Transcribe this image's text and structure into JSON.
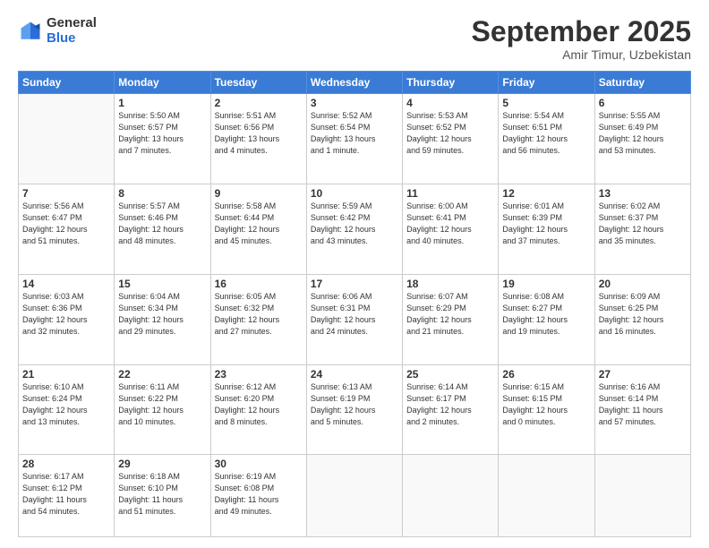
{
  "logo": {
    "general": "General",
    "blue": "Blue"
  },
  "header": {
    "month": "September 2025",
    "location": "Amir Timur, Uzbekistan"
  },
  "weekdays": [
    "Sunday",
    "Monday",
    "Tuesday",
    "Wednesday",
    "Thursday",
    "Friday",
    "Saturday"
  ],
  "weeks": [
    [
      {
        "day": "",
        "info": ""
      },
      {
        "day": "1",
        "info": "Sunrise: 5:50 AM\nSunset: 6:57 PM\nDaylight: 13 hours\nand 7 minutes."
      },
      {
        "day": "2",
        "info": "Sunrise: 5:51 AM\nSunset: 6:56 PM\nDaylight: 13 hours\nand 4 minutes."
      },
      {
        "day": "3",
        "info": "Sunrise: 5:52 AM\nSunset: 6:54 PM\nDaylight: 13 hours\nand 1 minute."
      },
      {
        "day": "4",
        "info": "Sunrise: 5:53 AM\nSunset: 6:52 PM\nDaylight: 12 hours\nand 59 minutes."
      },
      {
        "day": "5",
        "info": "Sunrise: 5:54 AM\nSunset: 6:51 PM\nDaylight: 12 hours\nand 56 minutes."
      },
      {
        "day": "6",
        "info": "Sunrise: 5:55 AM\nSunset: 6:49 PM\nDaylight: 12 hours\nand 53 minutes."
      }
    ],
    [
      {
        "day": "7",
        "info": "Sunrise: 5:56 AM\nSunset: 6:47 PM\nDaylight: 12 hours\nand 51 minutes."
      },
      {
        "day": "8",
        "info": "Sunrise: 5:57 AM\nSunset: 6:46 PM\nDaylight: 12 hours\nand 48 minutes."
      },
      {
        "day": "9",
        "info": "Sunrise: 5:58 AM\nSunset: 6:44 PM\nDaylight: 12 hours\nand 45 minutes."
      },
      {
        "day": "10",
        "info": "Sunrise: 5:59 AM\nSunset: 6:42 PM\nDaylight: 12 hours\nand 43 minutes."
      },
      {
        "day": "11",
        "info": "Sunrise: 6:00 AM\nSunset: 6:41 PM\nDaylight: 12 hours\nand 40 minutes."
      },
      {
        "day": "12",
        "info": "Sunrise: 6:01 AM\nSunset: 6:39 PM\nDaylight: 12 hours\nand 37 minutes."
      },
      {
        "day": "13",
        "info": "Sunrise: 6:02 AM\nSunset: 6:37 PM\nDaylight: 12 hours\nand 35 minutes."
      }
    ],
    [
      {
        "day": "14",
        "info": "Sunrise: 6:03 AM\nSunset: 6:36 PM\nDaylight: 12 hours\nand 32 minutes."
      },
      {
        "day": "15",
        "info": "Sunrise: 6:04 AM\nSunset: 6:34 PM\nDaylight: 12 hours\nand 29 minutes."
      },
      {
        "day": "16",
        "info": "Sunrise: 6:05 AM\nSunset: 6:32 PM\nDaylight: 12 hours\nand 27 minutes."
      },
      {
        "day": "17",
        "info": "Sunrise: 6:06 AM\nSunset: 6:31 PM\nDaylight: 12 hours\nand 24 minutes."
      },
      {
        "day": "18",
        "info": "Sunrise: 6:07 AM\nSunset: 6:29 PM\nDaylight: 12 hours\nand 21 minutes."
      },
      {
        "day": "19",
        "info": "Sunrise: 6:08 AM\nSunset: 6:27 PM\nDaylight: 12 hours\nand 19 minutes."
      },
      {
        "day": "20",
        "info": "Sunrise: 6:09 AM\nSunset: 6:25 PM\nDaylight: 12 hours\nand 16 minutes."
      }
    ],
    [
      {
        "day": "21",
        "info": "Sunrise: 6:10 AM\nSunset: 6:24 PM\nDaylight: 12 hours\nand 13 minutes."
      },
      {
        "day": "22",
        "info": "Sunrise: 6:11 AM\nSunset: 6:22 PM\nDaylight: 12 hours\nand 10 minutes."
      },
      {
        "day": "23",
        "info": "Sunrise: 6:12 AM\nSunset: 6:20 PM\nDaylight: 12 hours\nand 8 minutes."
      },
      {
        "day": "24",
        "info": "Sunrise: 6:13 AM\nSunset: 6:19 PM\nDaylight: 12 hours\nand 5 minutes."
      },
      {
        "day": "25",
        "info": "Sunrise: 6:14 AM\nSunset: 6:17 PM\nDaylight: 12 hours\nand 2 minutes."
      },
      {
        "day": "26",
        "info": "Sunrise: 6:15 AM\nSunset: 6:15 PM\nDaylight: 12 hours\nand 0 minutes."
      },
      {
        "day": "27",
        "info": "Sunrise: 6:16 AM\nSunset: 6:14 PM\nDaylight: 11 hours\nand 57 minutes."
      }
    ],
    [
      {
        "day": "28",
        "info": "Sunrise: 6:17 AM\nSunset: 6:12 PM\nDaylight: 11 hours\nand 54 minutes."
      },
      {
        "day": "29",
        "info": "Sunrise: 6:18 AM\nSunset: 6:10 PM\nDaylight: 11 hours\nand 51 minutes."
      },
      {
        "day": "30",
        "info": "Sunrise: 6:19 AM\nSunset: 6:08 PM\nDaylight: 11 hours\nand 49 minutes."
      },
      {
        "day": "",
        "info": ""
      },
      {
        "day": "",
        "info": ""
      },
      {
        "day": "",
        "info": ""
      },
      {
        "day": "",
        "info": ""
      }
    ]
  ]
}
